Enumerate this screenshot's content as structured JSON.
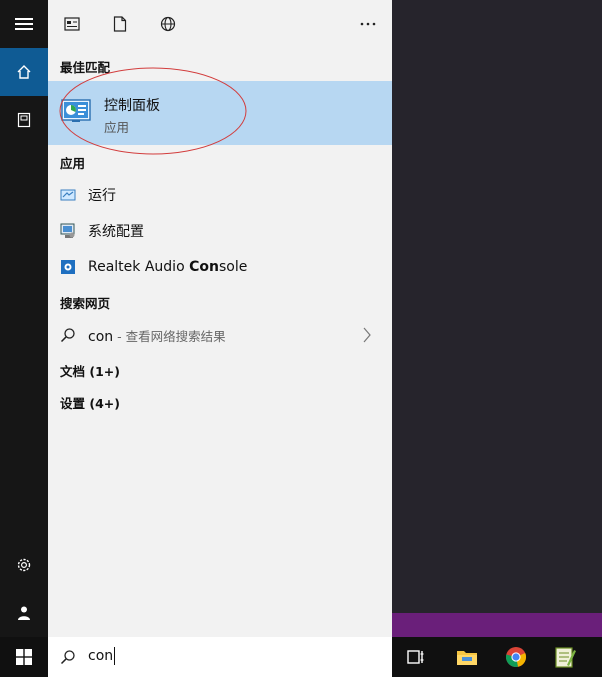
{
  "panel": {
    "sections": {
      "best_match": "最佳匹配",
      "apps": "应用",
      "search_web": "搜索网页",
      "documents": "文档 (1+)",
      "settings": "设置 (4+)"
    },
    "best_match_item": {
      "title": "控制面板",
      "subtitle": "应用"
    },
    "apps": [
      {
        "label": "运行"
      },
      {
        "label": "系统配置"
      },
      {
        "label_pre": "Realtek Audio ",
        "label_bold": "Con",
        "label_post": "sole"
      }
    ],
    "web": {
      "query": "con",
      "suffix": " - 查看网络搜索结果"
    }
  },
  "search": {
    "value": "con"
  },
  "colors": {
    "rail": "#161616",
    "panel": "#f2f2f2",
    "best_match_bg": "#b7d7f2",
    "accent": "#0f5b94",
    "purple": "#6a1f7a"
  },
  "icons": {
    "rail": [
      "hamburger-icon",
      "home-icon",
      "documents-icon",
      "settings-icon",
      "user-icon"
    ],
    "top": [
      "news-icon",
      "document-icon",
      "globe-icon",
      "more-icon"
    ],
    "taskbar": [
      "windows-icon",
      "task-view-icon",
      "file-explorer-icon",
      "chrome-icon",
      "notepad-icon"
    ]
  }
}
